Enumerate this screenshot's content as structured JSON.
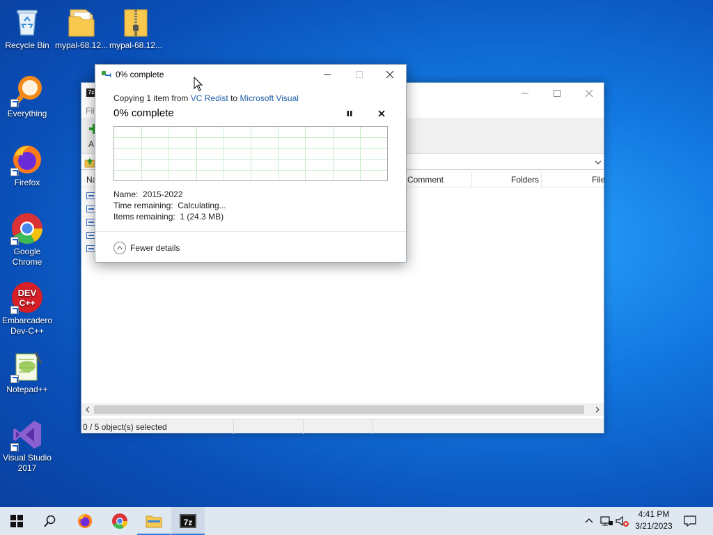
{
  "desktop": {
    "icons": [
      {
        "label": "Recycle Bin"
      },
      {
        "label": "mypal-68.12..."
      },
      {
        "label": "mypal-68.12..."
      },
      {
        "label": "Everything"
      },
      {
        "label": "Firefox"
      },
      {
        "label": "Google Chrome"
      },
      {
        "label": "Embarcadero Dev-C++"
      },
      {
        "label": "Notepad++"
      },
      {
        "label": "Visual Studio 2017"
      }
    ]
  },
  "sevenzip": {
    "logo": "7z",
    "menu_partial": "Fil",
    "toolbar_partial": "A",
    "columns": {
      "name": "Na",
      "comment": "Comment",
      "folders": "Folders",
      "files": "File"
    },
    "status": "0 / 5 object(s) selected"
  },
  "copy_dialog": {
    "title": "0% complete",
    "copy_prefix": "Copying 1 item from ",
    "source": "VC Redist",
    "to": " to ",
    "destination": "Microsoft Visual",
    "progress_label": "0% complete",
    "progress": 0,
    "name_label": "Name:",
    "name_value": "2015-2022",
    "time_label": "Time remaining:",
    "time_value": "Calculating...",
    "items_label": "Items remaining:",
    "items_value": "1 (24.3 MB)",
    "fewer_details": "Fewer details"
  },
  "taskbar": {
    "time": "4:41 PM",
    "date": "3/21/2023",
    "running_app": "7z"
  },
  "colors": {
    "link": "#1f5fa8",
    "grid": "#c8ecc8",
    "taskbar": "#dfe7f1"
  }
}
